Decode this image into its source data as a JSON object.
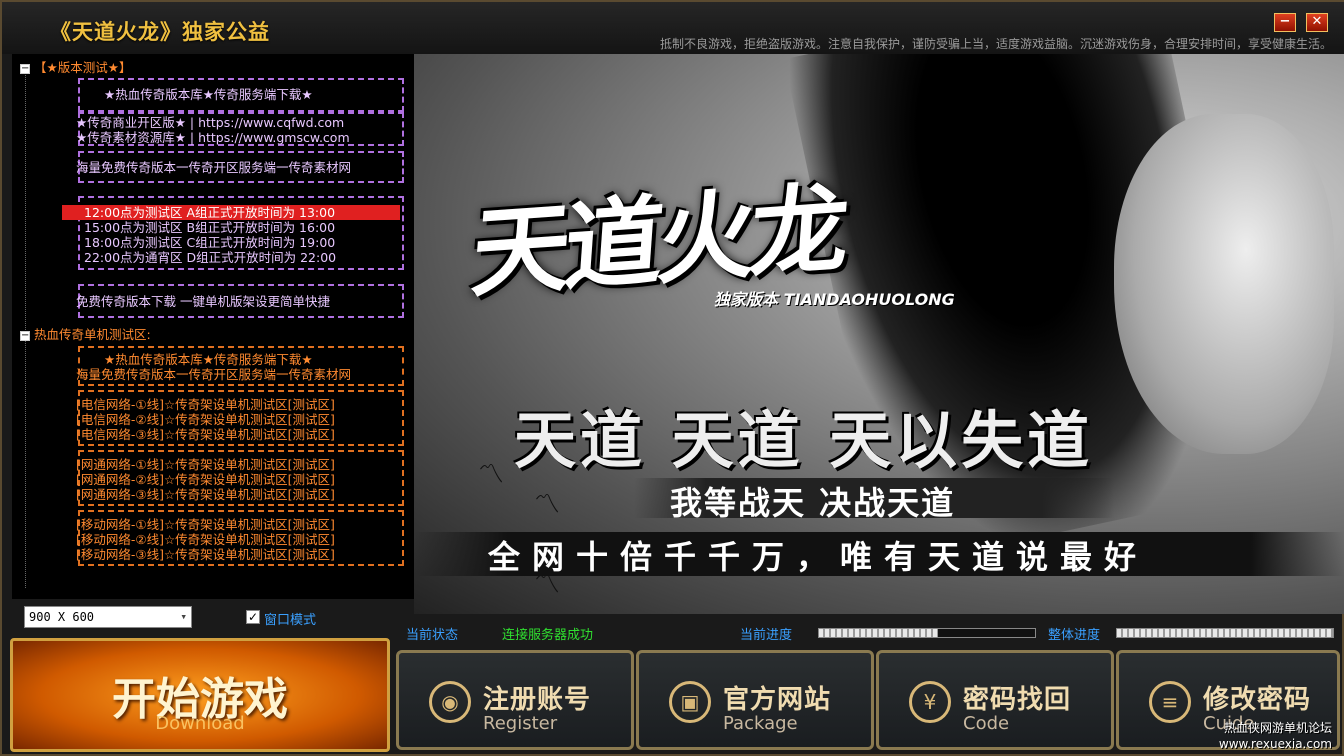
{
  "window": {
    "title": "《天道火龙》独家公益",
    "notice": "抵制不良游戏，拒绝盗版游戏。注意自我保护，谨防受骗上当，适度游戏益脑。沉迷游戏伤身，合理安排时间，享受健康生活。",
    "min_label": "−",
    "close_label": "✕"
  },
  "tree": {
    "group1_label": "【★版本测试★】",
    "group1_box": "−",
    "group1_lines": [
      "★热血传奇版本库★传奇服务端下载★",
      "★传奇商业开区版★ | https://www.cqfwd.com",
      "★传奇素材资源库★ | https://www.gmscw.com",
      "海量免费传奇版本一传奇开区服务端一传奇素材网",
      "12:00点为测试区    A组正式开放时间为 13:00",
      "15:00点为测试区    B组正式开放时间为 16:00",
      "18:00点为测试区    C组正式开放时间为 19:00",
      "22:00点为通宵区    D组正式开放时间为 22:00",
      "免费传奇版本下载   一键单机版架设更简单快捷"
    ],
    "group2_label": "热血传奇单机测试区:",
    "group2_box": "−",
    "group2_lines": [
      "★热血传奇版本库★传奇服务端下载★",
      "海量免费传奇版本一传奇开区服务端一传奇素材网",
      "[电信网络-①线]☆传奇架设单机测试区[测试区]",
      "[电信网络-②线]☆传奇架设单机测试区[测试区]",
      "[电信网络-③线]☆传奇架设单机测试区[测试区]",
      "[网通网络-①线]☆传奇架设单机测试区[测试区]",
      "[网通网络-②线]☆传奇架设单机测试区[测试区]",
      "[网通网络-③线]☆传奇架设单机测试区[测试区]",
      "[移动网络-①线]☆传奇架设单机测试区[测试区]",
      "[移动网络-②线]☆传奇架设单机测试区[测试区]",
      "[移动网络-③线]☆传奇架设单机测试区[测试区]"
    ]
  },
  "banner": {
    "calligraphy": "天道火龙",
    "edition": "独家版本 TIANDAOHUOLONG",
    "slogan1": "天道 天道 天以失道",
    "slogan2": "我等战天 决战天道",
    "slogan3": "全网十倍千千万，唯有天道说最好"
  },
  "controls": {
    "resolution": "900 X 600",
    "window_mode_label": "窗口模式",
    "window_mode_checked": true,
    "status_label": "当前状态",
    "status_value": "连接服务器成功",
    "progress_label": "当前进度",
    "progress_value": 0.55,
    "overall_label": "整体进度",
    "overall_value": 0.0
  },
  "buttons": {
    "start_title": "开始游戏",
    "start_sub": "Download",
    "register_title": "注册账号",
    "register_sub": "Register",
    "site_title": "官方网站",
    "site_sub": "Package",
    "recover_title": "密码找回",
    "recover_sub": "Code",
    "change_title": "修改密码",
    "change_sub": "Cuide"
  },
  "watermark": {
    "line1": "热血侠网游单机论坛",
    "line2": "www.rexuexia.com"
  },
  "colors": {
    "title": "#f0c040",
    "purple_text": "#e8c8ff",
    "orange_text": "#ff8a30",
    "status_ok": "#30e030",
    "label_blue": "#3aa0ff"
  }
}
